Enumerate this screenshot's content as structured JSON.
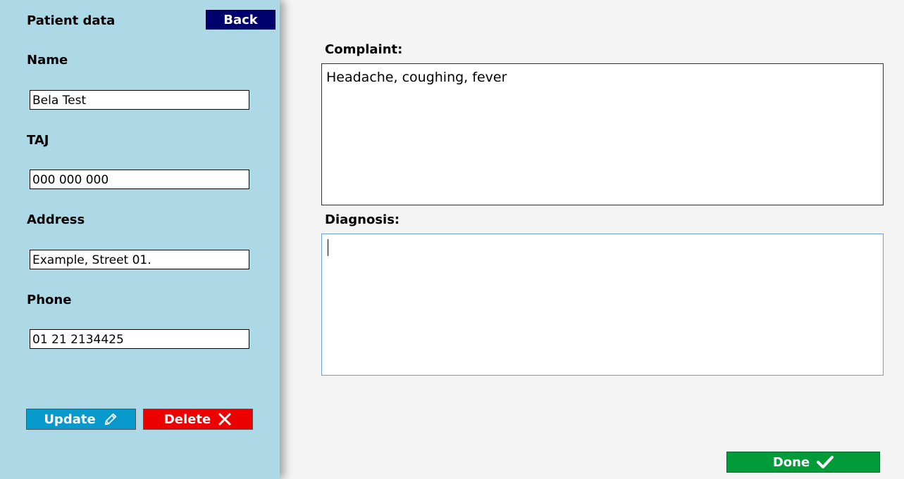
{
  "sidebar": {
    "title": "Patient data",
    "back_label": "Back",
    "fields": [
      {
        "label": "Name",
        "value": "Bela Test"
      },
      {
        "label": "TAJ",
        "value": "000 000 000"
      },
      {
        "label": "Address",
        "value": "Example, Street 01."
      },
      {
        "label": "Phone",
        "value": "01 21 2134425"
      }
    ],
    "update_label": "Update",
    "update_icon": "pencil-icon",
    "delete_label": "Delete",
    "delete_icon": "x-icon"
  },
  "main": {
    "complaint_label": "Complaint:",
    "complaint_value": "Headache, coughing, fever",
    "diagnosis_label": "Diagnosis:",
    "diagnosis_value": "",
    "done_label": "Done",
    "done_icon": "checkmark-icon"
  },
  "colors": {
    "sidebar_bg": "#add8e6",
    "back_button": "#00006e",
    "update_button": "#0798cc",
    "delete_button": "#ec0000",
    "done_button": "#029b3a",
    "main_bg": "#f4f4f4"
  }
}
